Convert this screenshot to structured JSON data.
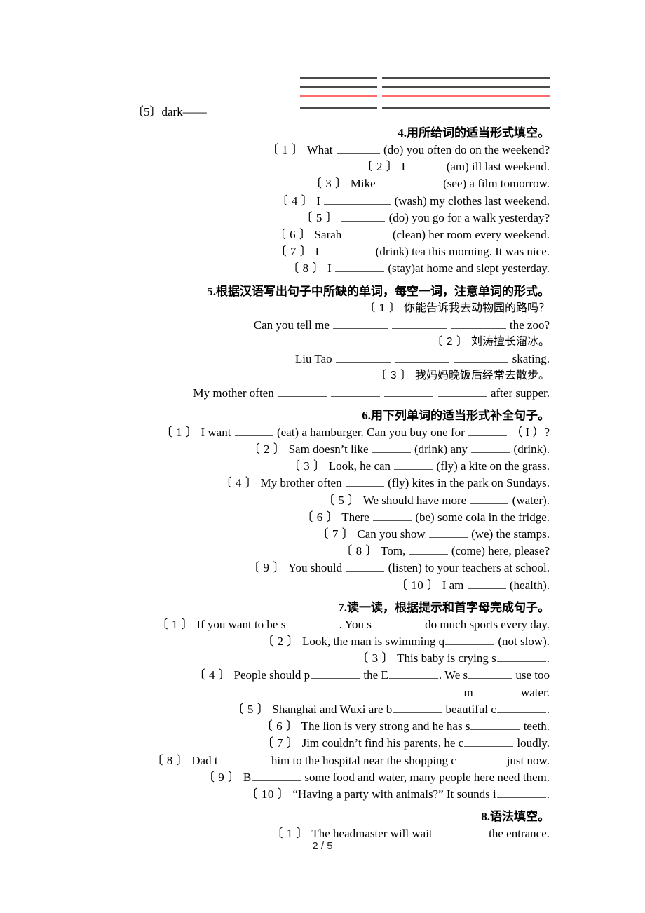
{
  "document": {
    "page_footer": "2 / 5",
    "colors": {
      "rule_dark": "#4a4a4a",
      "rule_red": "#ff6b6b",
      "text": "#000000",
      "blank_line": "#555555"
    }
  },
  "top_block": {
    "leftover_item_label": "〔5〕dark——",
    "rules": [
      {
        "color": "dark"
      },
      {
        "color": "dark"
      },
      {
        "color": "red"
      },
      {
        "color": "dark"
      }
    ]
  },
  "sections": {
    "s4": {
      "number": "4.",
      "title": "用所给词的适当形式填空。",
      "items": [
        {
          "n": "〔 1 〕",
          "pre": "What",
          "blank": "w62",
          "post": "(do) you often do on the weekend?"
        },
        {
          "n": "〔 2 〕",
          "pre": "I",
          "blank": "w48",
          "post": "(am) ill last weekend."
        },
        {
          "n": "〔 3 〕",
          "pre": "Mike",
          "blank": "w86",
          "post": "(see) a film tomorrow."
        },
        {
          "n": "〔 4 〕",
          "pre": "I",
          "blank": "w95",
          "post": "(wash) my clothes last weekend."
        },
        {
          "n": "〔 5 〕",
          "pre": "",
          "blank": "w62",
          "post": "(do) you go for a walk yesterday?"
        },
        {
          "n": "〔 6 〕",
          "pre": "Sarah",
          "blank": "w62",
          "post": "(clean) her room every weekend."
        },
        {
          "n": "〔 7 〕",
          "pre": "I",
          "blank": "w70",
          "post": "(drink) tea this morning. It was nice."
        },
        {
          "n": "〔 8 〕",
          "pre": "I",
          "blank": "w70",
          "post": "(stay)at home and slept yesterday."
        }
      ]
    },
    "s5": {
      "number": "5.",
      "title": "根据汉语写出句子中所缺的单词，每空一词，注意单词的形式。",
      "items": [
        {
          "n": "〔 1 〕",
          "cn": "你能告诉我去动物园的路吗？",
          "en_pre": "Can you tell me",
          "blanks": [
            "w78",
            "w78",
            "w78"
          ],
          "en_post": "the zoo?"
        },
        {
          "n": "〔 2 〕",
          "cn": "刘涛擅长溜冰。",
          "en_pre": "Liu Tao",
          "blanks": [
            "w78",
            "w78",
            "w78"
          ],
          "en_post": "skating."
        },
        {
          "n": "〔 3 〕",
          "cn": "我妈妈晚饭后经常去散步。",
          "en_pre": "My mother often",
          "blanks": [
            "w70",
            "w70",
            "w70",
            "w70"
          ],
          "en_post": "after supper."
        }
      ]
    },
    "s6": {
      "number": "6.",
      "title": "用下列单词的适当形式补全句子。",
      "items": [
        {
          "n": "〔 1 〕",
          "pre": "I want",
          "blank": "w55",
          "mid": "(eat) a hamburger. Can you buy one for",
          "blank2": "w55",
          "post": "（ I ）?"
        },
        {
          "n": "〔 2 〕",
          "pre": "Sam doesn’t like",
          "blank": "w55",
          "mid": "(drink) any",
          "blank2": "w55",
          "post": "(drink)."
        },
        {
          "n": "〔 3 〕",
          "pre": "Look, he can",
          "blank": "w55",
          "post": "(fly) a kite on the grass."
        },
        {
          "n": "〔 4 〕",
          "pre": "My brother often",
          "blank": "w55",
          "post": "(fly) kites in the park on Sundays."
        },
        {
          "n": "〔 5 〕",
          "pre": "We should have more",
          "blank": "w55",
          "post": "(water)."
        },
        {
          "n": "〔 6 〕",
          "pre": "There",
          "blank": "w55",
          "post": "(be) some cola in the fridge."
        },
        {
          "n": "〔 7 〕",
          "pre": "Can you show",
          "blank": "w55",
          "post": "(we) the stamps."
        },
        {
          "n": "〔 8 〕",
          "pre": "Tom,",
          "blank": "w55",
          "post": "(come) here, please?"
        },
        {
          "n": "〔 9 〕",
          "pre": "You should",
          "blank": "w55",
          "post": "(listen) to your teachers at school."
        },
        {
          "n": "〔 10 〕",
          "pre": "I am",
          "blank": "w55",
          "post": "(health)."
        }
      ]
    },
    "s7": {
      "number": "7.",
      "title": "读一读，根据提示和首字母完成句子。",
      "items": [
        {
          "n": "〔 1 〕",
          "pre": "If you want to be s",
          "blank": "w70",
          "mid": ". You s",
          "blank2": "w70",
          "post": "do much sports every day."
        },
        {
          "n": "〔 2 〕",
          "pre": "Look, the man is swimming q",
          "blank": "w70",
          "post": "(not slow)."
        },
        {
          "n": "〔 3 〕",
          "pre": "This baby is crying s",
          "blank": "w70",
          "post": "."
        },
        {
          "n": "〔 4 〕",
          "pre": "People should p",
          "blank": "w70",
          "mid": "the E",
          "blank2": "w70",
          "mid2": ". We s",
          "blank3": "w62",
          "post": "use too"
        },
        {
          "n": "",
          "pre": "m",
          "blank": "w62",
          "post": "water.",
          "continuation": true
        },
        {
          "n": "〔 5 〕",
          "pre": "Shanghai and Wuxi are b",
          "blank": "w70",
          "mid": "beautiful c",
          "blank2": "w70",
          "post": "."
        },
        {
          "n": "〔 6 〕",
          "pre": "The lion is very strong and he has s",
          "blank": "w70",
          "post": "teeth."
        },
        {
          "n": "〔 7 〕",
          "pre": "Jim couldn’t find his parents, he c",
          "blank": "w70",
          "post": "loudly."
        },
        {
          "n": "〔 8 〕",
          "pre": "Dad t",
          "blank": "w70",
          "mid": "him to the hospital near the shopping c",
          "blank2": "w70",
          "post": "just now."
        },
        {
          "n": "〔 9 〕",
          "pre": "B",
          "blank": "w70",
          "post": "some food and water, many people here need them."
        },
        {
          "n": "〔 10 〕",
          "pre": "“Having a party with animals?” It sounds i",
          "blank": "w70",
          "post": "."
        }
      ]
    },
    "s8": {
      "number": "8.",
      "title": "语法填空。",
      "items": [
        {
          "n": "〔 1 〕",
          "pre": "The headmaster will wait",
          "blank": "w70",
          "post": "the entrance."
        }
      ]
    }
  }
}
